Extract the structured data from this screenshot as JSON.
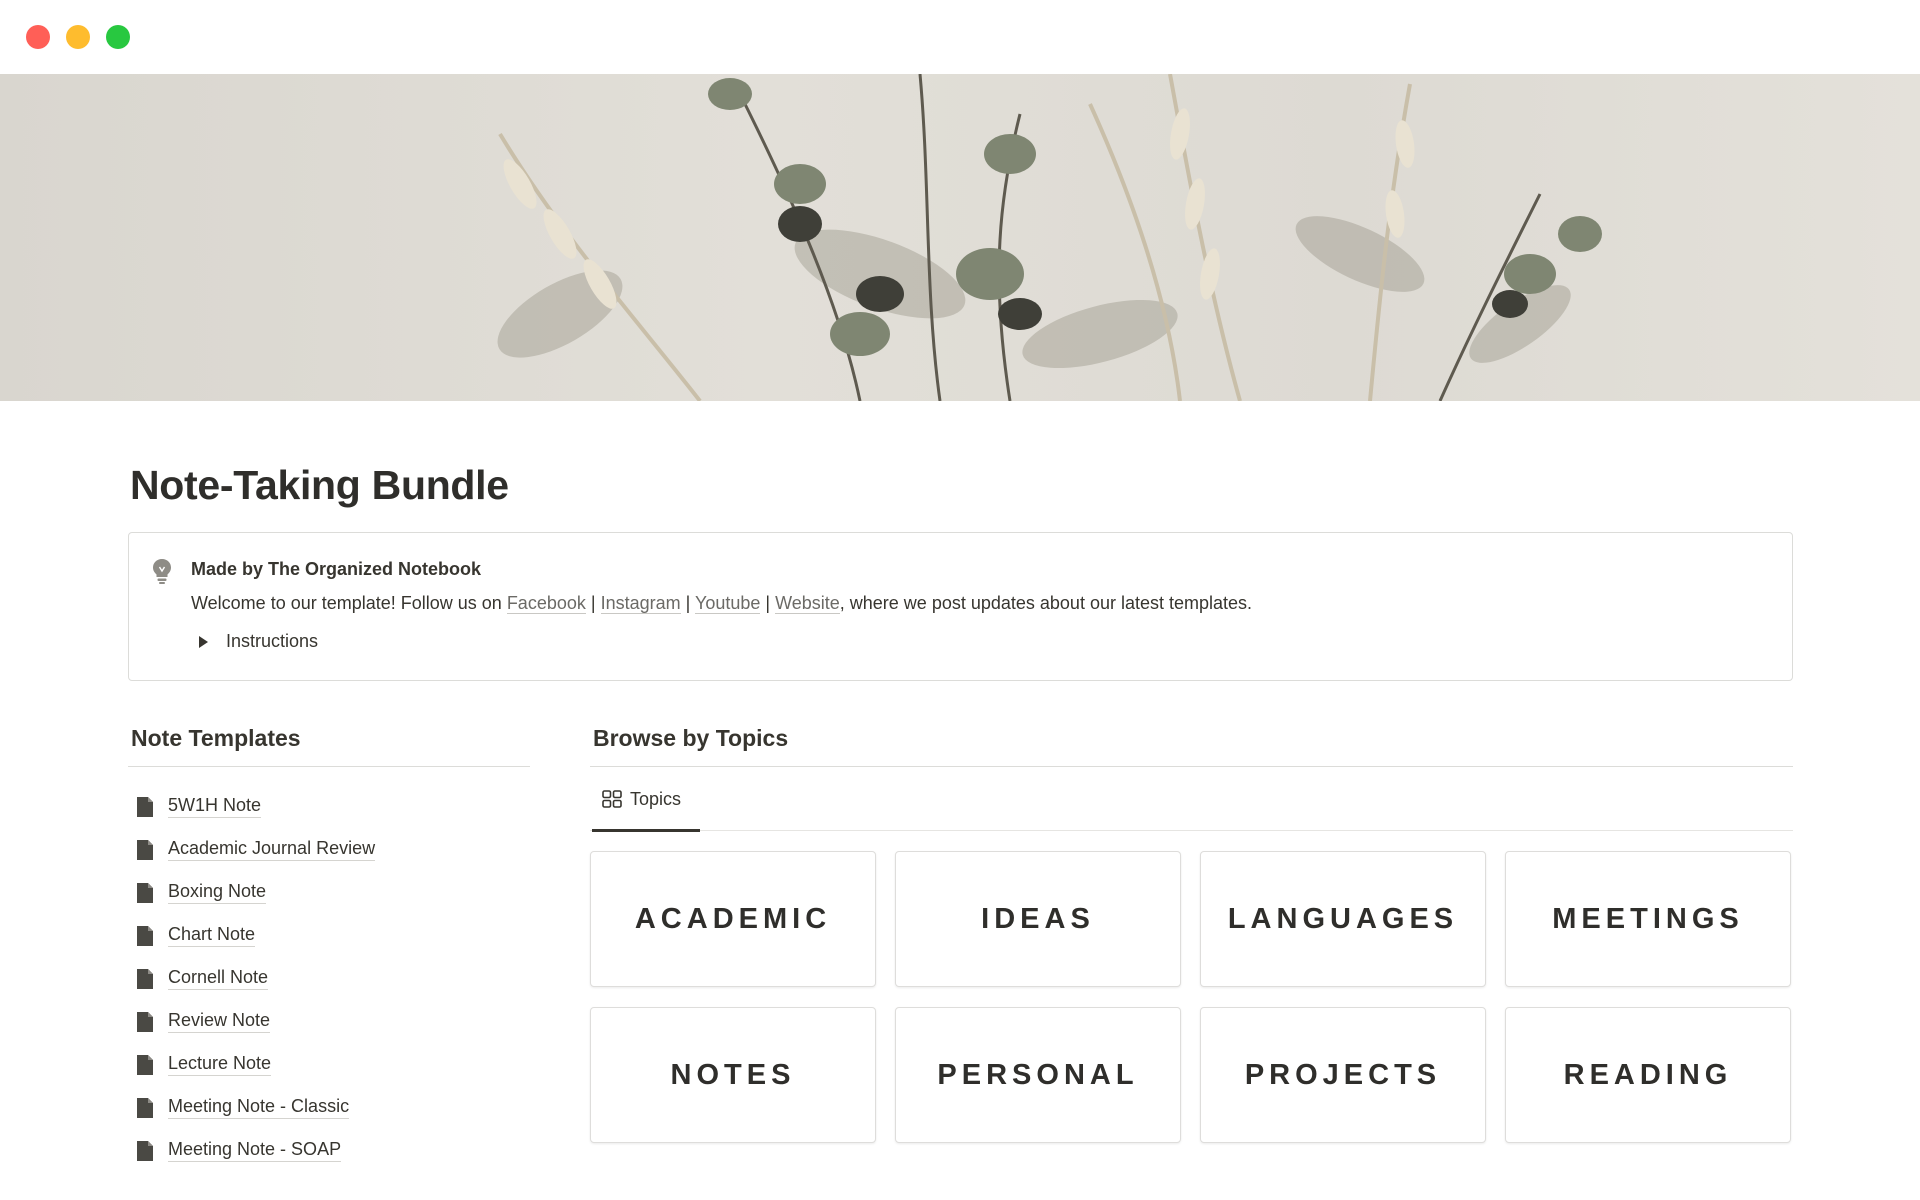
{
  "page": {
    "title": "Note-Taking Bundle"
  },
  "callout": {
    "icon": "lightbulb-icon",
    "title": "Made by The Organized Notebook",
    "text_prefix": "Welcome to our template! Follow us on ",
    "links": [
      "Facebook",
      "Instagram",
      "Youtube",
      "Website"
    ],
    "separator": " | ",
    "text_suffix": ", where we post updates about our latest templates.",
    "toggle_label": "Instructions"
  },
  "note_templates": {
    "heading": "Note Templates",
    "items": [
      "5W1H Note",
      "Academic Journal Review",
      "Boxing Note",
      "Chart Note",
      "Cornell Note",
      "Review Note",
      "Lecture Note",
      "Meeting Note - Classic",
      "Meeting Note - SOAP"
    ]
  },
  "topics": {
    "heading": "Browse by Topics",
    "view_tab_label": "Topics",
    "cards": [
      "ACADEMIC",
      "IDEAS",
      "LANGUAGES",
      "MEETINGS",
      "NOTES",
      "PERSONAL",
      "PROJECTS",
      "READING"
    ]
  },
  "colors": {
    "text": "#37352f",
    "border": "#dcdcd9",
    "close": "#ff5f57",
    "minimize": "#febc2e",
    "zoom": "#28c840"
  }
}
